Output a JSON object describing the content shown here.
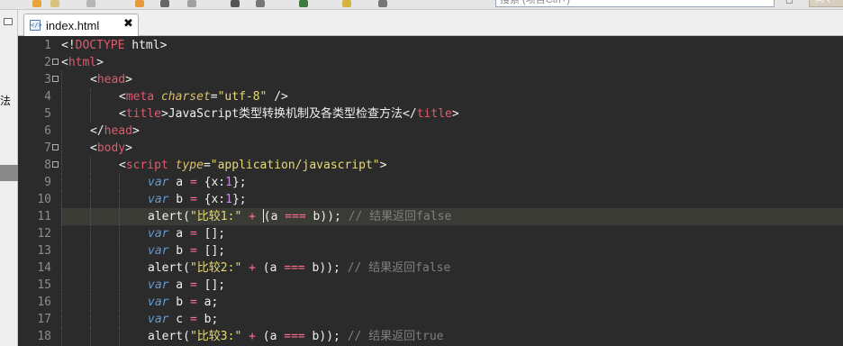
{
  "toolbar": {
    "search_placeholder": "搜索 (项目Ctrl+)",
    "right_button_label": "同 (",
    "icons": [
      "new-file-icon",
      "open-icon",
      "save-icon",
      "run-icon",
      "undo-icon",
      "redo-icon",
      "font-a-icon",
      "font-a-italic-icon",
      "browser-icon",
      "chrome-icon",
      "preview-icon"
    ]
  },
  "left_panel": {
    "visible_text": "法"
  },
  "tabs": [
    {
      "label": "index.html",
      "close": "✖",
      "active": true
    }
  ],
  "editor": {
    "current_line": 11,
    "lines": [
      {
        "n": "1",
        "fold": false,
        "indent": 0,
        "tokens": [
          [
            "pl",
            "<!"
          ],
          [
            "doctype",
            "DOCTYPE"
          ],
          [
            "pl",
            " html>"
          ]
        ]
      },
      {
        "n": "2",
        "fold": true,
        "indent": 0,
        "tokens": [
          [
            "pl",
            "<"
          ],
          [
            "tag",
            "html"
          ],
          [
            "pl",
            ">"
          ]
        ]
      },
      {
        "n": "3",
        "fold": true,
        "indent": 1,
        "tokens": [
          [
            "pl",
            "<"
          ],
          [
            "tag",
            "head"
          ],
          [
            "pl",
            ">"
          ]
        ]
      },
      {
        "n": "4",
        "fold": false,
        "indent": 2,
        "tokens": [
          [
            "pl",
            "<"
          ],
          [
            "tag",
            "meta"
          ],
          [
            "pl",
            " "
          ],
          [
            "attr",
            "charset"
          ],
          [
            "pl",
            "="
          ],
          [
            "str",
            "\"utf-8\""
          ],
          [
            "pl",
            " />"
          ]
        ]
      },
      {
        "n": "5",
        "fold": false,
        "indent": 2,
        "tokens": [
          [
            "pl",
            "<"
          ],
          [
            "tag",
            "title"
          ],
          [
            "pl",
            ">JavaScript类型转换机制及各类型检查方法</"
          ],
          [
            "tag",
            "title"
          ],
          [
            "pl",
            ">"
          ]
        ]
      },
      {
        "n": "6",
        "fold": false,
        "indent": 1,
        "tokens": [
          [
            "pl",
            "</"
          ],
          [
            "tag",
            "head"
          ],
          [
            "pl",
            ">"
          ]
        ]
      },
      {
        "n": "7",
        "fold": true,
        "indent": 1,
        "tokens": [
          [
            "pl",
            "<"
          ],
          [
            "tag",
            "body"
          ],
          [
            "pl",
            ">"
          ]
        ]
      },
      {
        "n": "8",
        "fold": true,
        "indent": 2,
        "tokens": [
          [
            "pl",
            "<"
          ],
          [
            "tag",
            "script"
          ],
          [
            "pl",
            " "
          ],
          [
            "attr",
            "type"
          ],
          [
            "pl",
            "="
          ],
          [
            "str",
            "\"application/javascript\""
          ],
          [
            "pl",
            ">"
          ]
        ]
      },
      {
        "n": "9",
        "fold": false,
        "indent": 3,
        "tokens": [
          [
            "kw",
            "var"
          ],
          [
            "pl",
            " a "
          ],
          [
            "pnk",
            "="
          ],
          [
            "pl",
            " {x:"
          ],
          [
            "num",
            "1"
          ],
          [
            "pl",
            "};"
          ]
        ]
      },
      {
        "n": "10",
        "fold": false,
        "indent": 3,
        "tokens": [
          [
            "kw",
            "var"
          ],
          [
            "pl",
            " b "
          ],
          [
            "pnk",
            "="
          ],
          [
            "pl",
            " {x:"
          ],
          [
            "num",
            "1"
          ],
          [
            "pl",
            "};"
          ]
        ]
      },
      {
        "n": "11",
        "fold": false,
        "indent": 3,
        "tokens": [
          [
            "pl",
            "alert("
          ],
          [
            "str",
            "\"比较1:\""
          ],
          [
            "pl",
            " "
          ],
          [
            "pnk",
            "+"
          ],
          [
            "pl",
            " "
          ],
          [
            "cursor",
            ""
          ],
          [
            "pl",
            "(a "
          ],
          [
            "pnk",
            "==="
          ],
          [
            "pl",
            " b)); "
          ],
          [
            "cmt",
            "// 结果返回false"
          ]
        ]
      },
      {
        "n": "12",
        "fold": false,
        "indent": 3,
        "tokens": [
          [
            "kw",
            "var"
          ],
          [
            "pl",
            " a "
          ],
          [
            "pnk",
            "="
          ],
          [
            "pl",
            " [];"
          ]
        ]
      },
      {
        "n": "13",
        "fold": false,
        "indent": 3,
        "tokens": [
          [
            "kw",
            "var"
          ],
          [
            "pl",
            " b "
          ],
          [
            "pnk",
            "="
          ],
          [
            "pl",
            " [];"
          ]
        ]
      },
      {
        "n": "14",
        "fold": false,
        "indent": 3,
        "tokens": [
          [
            "pl",
            "alert("
          ],
          [
            "str",
            "\"比较2:\""
          ],
          [
            "pl",
            " "
          ],
          [
            "pnk",
            "+"
          ],
          [
            "pl",
            " (a "
          ],
          [
            "pnk",
            "==="
          ],
          [
            "pl",
            " b)); "
          ],
          [
            "cmt",
            "// 结果返回false"
          ]
        ]
      },
      {
        "n": "15",
        "fold": false,
        "indent": 3,
        "tokens": [
          [
            "kw",
            "var"
          ],
          [
            "pl",
            " a "
          ],
          [
            "pnk",
            "="
          ],
          [
            "pl",
            " [];"
          ]
        ]
      },
      {
        "n": "16",
        "fold": false,
        "indent": 3,
        "tokens": [
          [
            "kw",
            "var"
          ],
          [
            "pl",
            " b "
          ],
          [
            "pnk",
            "="
          ],
          [
            "pl",
            " a;"
          ]
        ]
      },
      {
        "n": "17",
        "fold": false,
        "indent": 3,
        "tokens": [
          [
            "kw",
            "var"
          ],
          [
            "pl",
            " c "
          ],
          [
            "pnk",
            "="
          ],
          [
            "pl",
            " b;"
          ]
        ]
      },
      {
        "n": "18",
        "fold": false,
        "indent": 3,
        "tokens": [
          [
            "pl",
            "alert("
          ],
          [
            "str",
            "\"比较3:\""
          ],
          [
            "pl",
            " "
          ],
          [
            "pnk",
            "+"
          ],
          [
            "pl",
            " (a "
          ],
          [
            "pnk",
            "==="
          ],
          [
            "pl",
            " b)); "
          ],
          [
            "cmt",
            "// 结果返回true"
          ]
        ]
      }
    ]
  }
}
